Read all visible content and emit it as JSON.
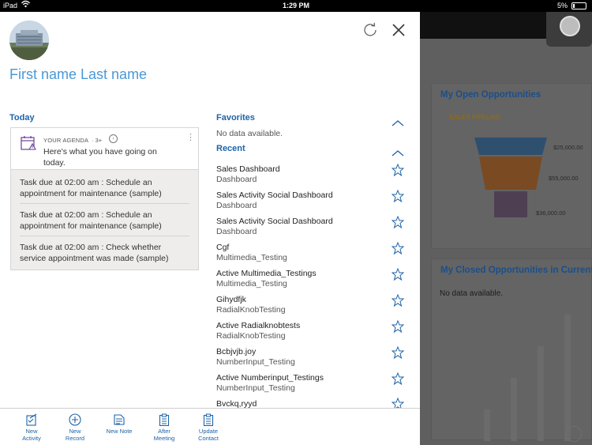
{
  "status_bar": {
    "device": "iPad",
    "time": "1:29 PM",
    "battery": "5%"
  },
  "panel": {
    "user_name": "First name Last name",
    "today": {
      "title": "Today",
      "agenda_label": "YOUR AGENDA",
      "agenda_count": "· 3+",
      "agenda_message": "Here's what you have going on today.",
      "tasks": [
        "Task due at 02:00 am : Schedule an appointment for maintenance (sample)",
        "Task due at 02:00 am : Schedule an appointment for maintenance (sample)",
        "Task due at 02:00 am : Check whether service appointment was made (sample)"
      ]
    },
    "favorites": {
      "title": "Favorites",
      "empty_text": "No data available."
    },
    "recent": {
      "title": "Recent",
      "items": [
        {
          "name": "Sales Dashboard",
          "type": "Dashboard"
        },
        {
          "name": "Sales Activity Social Dashboard",
          "type": "Dashboard"
        },
        {
          "name": "Sales Activity Social Dashboard",
          "type": "Dashboard"
        },
        {
          "name": "Cgf",
          "type": "Multimedia_Testing"
        },
        {
          "name": "Active Multimedia_Testings",
          "type": "Multimedia_Testing"
        },
        {
          "name": "Gihydfjk",
          "type": "RadialKnobTesting"
        },
        {
          "name": "Active Radialknobtests",
          "type": "RadialKnobTesting"
        },
        {
          "name": "Bcbjvjb.joy",
          "type": "NumberInput_Testing"
        },
        {
          "name": "Active Numberinput_Testings",
          "type": "NumberInput_Testing"
        },
        {
          "name": "Bvckq,ryyd",
          "type": ""
        }
      ]
    },
    "actions": [
      {
        "line1": "New",
        "line2": "Activity",
        "icon": "new-activity-icon"
      },
      {
        "line1": "New",
        "line2": "Record",
        "icon": "plus-circle-icon"
      },
      {
        "line1": "New Note",
        "line2": "",
        "icon": "note-icon"
      },
      {
        "line1": "After",
        "line2": "Meeting",
        "icon": "clipboard-icon"
      },
      {
        "line1": "Update",
        "line2": "Contact",
        "icon": "contact-update-icon"
      }
    ]
  },
  "background": {
    "open_opportunities": {
      "title": "My Open Opportunities",
      "subtitle": "SALES PIPELINE",
      "labels": [
        "$25,000.00",
        "$55,000.00",
        "$36,000.00"
      ]
    },
    "closed_opportunities": {
      "title": "My Closed Opportunities in Current ...",
      "empty_text": "No data available."
    }
  },
  "colors": {
    "accent": "#1e63a8",
    "name_blue": "#4a98d6",
    "funnel_1": "#2f4f6e",
    "funnel_2": "#7a4a22",
    "funnel_3": "#4e3f53"
  }
}
